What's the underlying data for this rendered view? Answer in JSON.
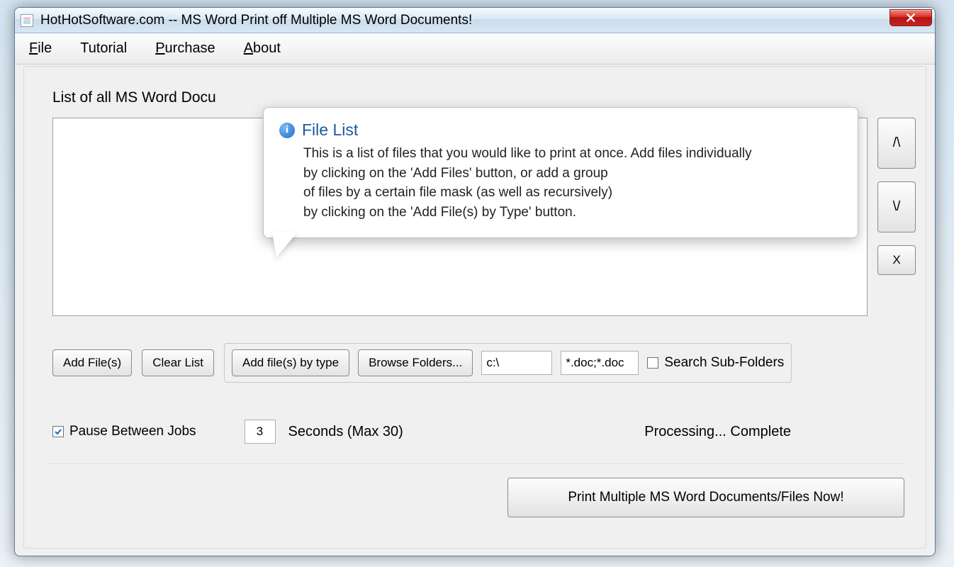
{
  "window": {
    "title": "HotHotSoftware.com -- MS Word Print off Multiple MS Word Documents!"
  },
  "menu": {
    "file": "File",
    "tutorial": "Tutorial",
    "purchase": "Purchase",
    "about": "About"
  },
  "labels": {
    "section": "List of all MS Word Docu",
    "seconds": "Seconds (Max 30)",
    "status": "Processing... Complete"
  },
  "buttons": {
    "up": "/\\",
    "down": "\\/",
    "remove": "X",
    "add_files": "Add File(s)",
    "clear_list": "Clear List",
    "add_by_type": "Add file(s) by type",
    "browse_folders": "Browse Folders...",
    "print_now": "Print Multiple MS Word Documents/Files Now!"
  },
  "inputs": {
    "path": "c:\\",
    "mask": "*.doc;*.doc",
    "pause_seconds": "3"
  },
  "checkboxes": {
    "search_sub": "Search Sub-Folders",
    "pause_between": "Pause Between Jobs",
    "pause_between_checked": true,
    "search_sub_checked": false
  },
  "balloon": {
    "title": "File List",
    "body": "This is a list of files that you would like to print at once. Add files individually\nby clicking on the 'Add Files' button, or add a group\nof files by a certain file mask (as well as recursively)\n by clicking on the 'Add File(s) by Type' button."
  }
}
